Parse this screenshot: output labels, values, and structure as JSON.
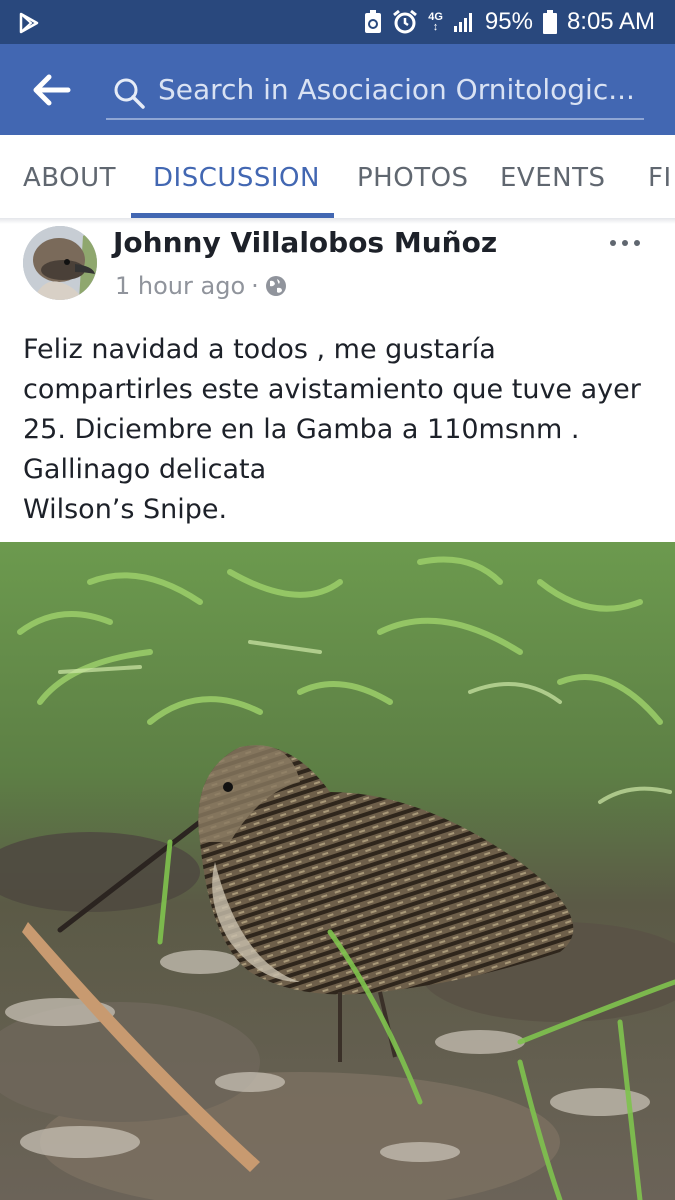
{
  "status_bar": {
    "network_top": "4G",
    "network_bottom": "↕",
    "battery": "95%",
    "time": "8:05 AM",
    "icons": [
      "play-store-icon",
      "battery-saver-icon",
      "alarm-icon",
      "signal-icon",
      "battery-icon"
    ]
  },
  "search": {
    "placeholder": "Search in Asociacion Ornitologic..."
  },
  "tabs": [
    {
      "label": "ABOUT"
    },
    {
      "label": "DISCUSSION",
      "active": true
    },
    {
      "label": "PHOTOS"
    },
    {
      "label": "EVENTS"
    },
    {
      "label": "FI"
    }
  ],
  "post": {
    "author": "Johnny Villalobos Muñoz",
    "time": "1 hour ago",
    "separator": "·",
    "privacy_icon": "globe-icon",
    "text_lines": [
      "Feliz navidad a todos , me gustaría",
      "compartirles este avistamiento que tuve ayer",
      "25. Diciembre en la Gamba a 110msnm .",
      "Gallinago delicata",
      "Wilson’s Snipe."
    ]
  },
  "colors": {
    "status_bar": "#29487d",
    "header": "#4267b2",
    "tab_active": "#4267b2",
    "tab_inactive": "#606770"
  }
}
